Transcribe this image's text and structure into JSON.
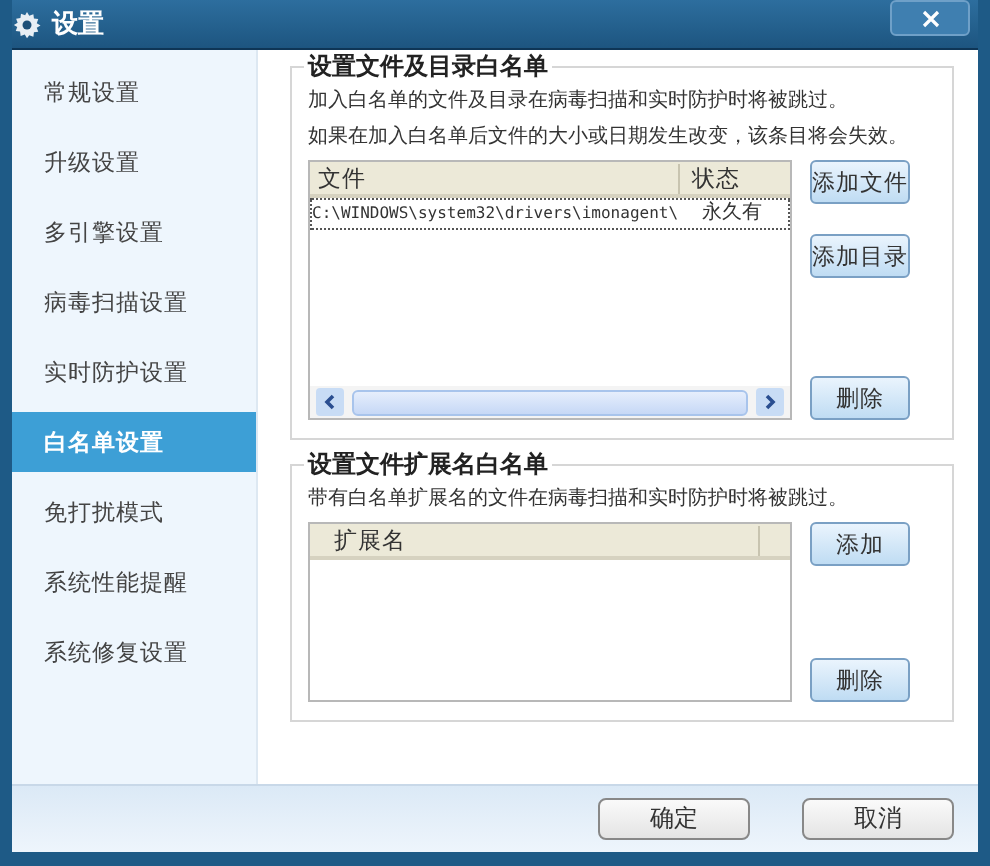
{
  "window": {
    "title": "设置"
  },
  "sidebar": {
    "items": [
      {
        "label": "常规设置",
        "selected": false
      },
      {
        "label": "升级设置",
        "selected": false
      },
      {
        "label": "多引擎设置",
        "selected": false
      },
      {
        "label": "病毒扫描设置",
        "selected": false
      },
      {
        "label": "实时防护设置",
        "selected": false
      },
      {
        "label": "白名单设置",
        "selected": true
      },
      {
        "label": "免打扰模式",
        "selected": false
      },
      {
        "label": "系统性能提醒",
        "selected": false
      },
      {
        "label": "系统修复设置",
        "selected": false
      }
    ]
  },
  "file_whitelist": {
    "title": "设置文件及目录白名单",
    "notes": [
      "加入白名单的文件及目录在病毒扫描和实时防护时将被跳过。",
      "如果在加入白名单后文件的大小或日期发生改变，该条目将会失效。"
    ],
    "columns": [
      "文件",
      "状态"
    ],
    "rows": [
      [
        "C:\\WINDOWS\\system32\\drivers\\imonagent\\",
        "永久有"
      ]
    ],
    "buttons": {
      "top": [
        "添加文件",
        "添加目录"
      ],
      "bottom": "删除"
    }
  },
  "extension_whitelist": {
    "title": "设置文件扩展名白名单",
    "note": "带有白名单扩展名的文件在病毒扫描和实时防护时将被跳过。",
    "columns": [
      "扩展名"
    ],
    "buttons": {
      "top": [
        "添加"
      ],
      "bottom": "删除"
    }
  },
  "footer": {
    "buttons": [
      "确定",
      "取消"
    ]
  }
}
